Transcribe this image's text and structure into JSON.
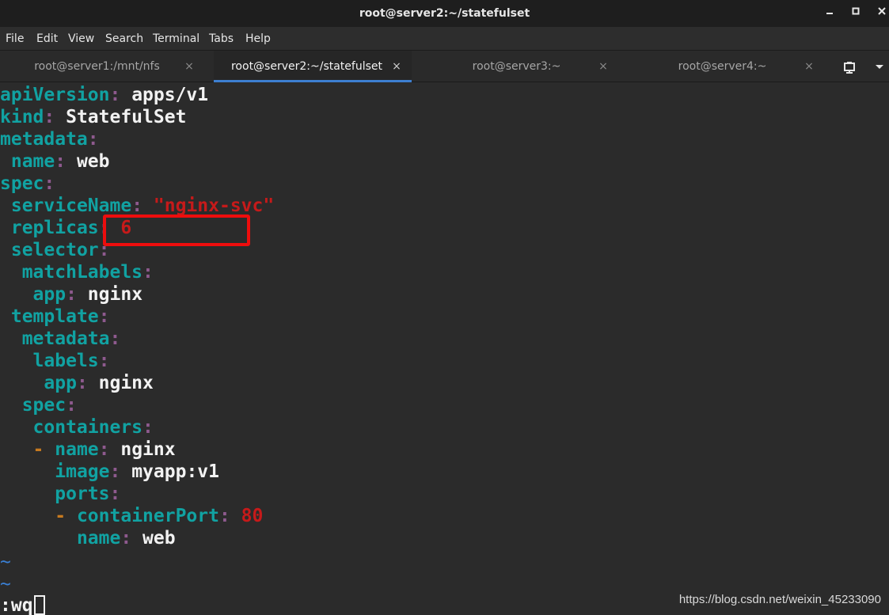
{
  "window": {
    "title": "root@server2:~/statefulset",
    "controls": {
      "minimize": "‒",
      "maximize": "▫",
      "close": "✕"
    }
  },
  "menu": [
    "File",
    "Edit",
    "View",
    "Search",
    "Terminal",
    "Tabs",
    "Help"
  ],
  "tabs": [
    {
      "label": "root@server1:/mnt/nfs",
      "close": "×",
      "active": false
    },
    {
      "label": "root@server2:~/statefulset",
      "close": "×",
      "active": true
    },
    {
      "label": "root@server3:~",
      "close": "×",
      "active": false
    },
    {
      "label": "root@server4:~",
      "close": "×",
      "active": false
    }
  ],
  "tabbar_buttons": {
    "new_tab_icon": "new-tab-icon",
    "menu_icon": "chevron-down-icon"
  },
  "editor": {
    "lines": [
      {
        "key": "apiVersion",
        "colon": ":",
        "value": " apps/v1"
      },
      {
        "key": "kind",
        "colon": ":",
        "value": " StatefulSet"
      },
      {
        "key": "metadata",
        "colon": ":",
        "value": ""
      },
      {
        "indent": " ",
        "key": "name",
        "colon": ":",
        "value": " web"
      },
      {
        "key": "spec",
        "colon": ":",
        "value": ""
      },
      {
        "indent": " ",
        "key": "serviceName",
        "colon": ":",
        "string": " \"nginx-svc\""
      },
      {
        "indent": " ",
        "key": "replicas",
        "colon": ":",
        "number": " 6"
      },
      {
        "indent": " ",
        "key": "selector",
        "colon": ":",
        "value": ""
      },
      {
        "indent": "  ",
        "key": "matchLabels",
        "colon": ":",
        "value": ""
      },
      {
        "indent": "   ",
        "key": "app",
        "colon": ":",
        "value": " nginx"
      },
      {
        "indent": " ",
        "key": "template",
        "colon": ":",
        "value": ""
      },
      {
        "indent": "  ",
        "key": "metadata",
        "colon": ":",
        "value": ""
      },
      {
        "indent": "   ",
        "key": "labels",
        "colon": ":",
        "value": ""
      },
      {
        "indent": "    ",
        "key": "app",
        "colon": ":",
        "value": " nginx"
      },
      {
        "indent": "  ",
        "key": "spec",
        "colon": ":",
        "value": ""
      },
      {
        "indent": "   ",
        "key": "containers",
        "colon": ":",
        "value": ""
      },
      {
        "indent": "   ",
        "dash": "- ",
        "key": "name",
        "colon": ":",
        "value": " nginx"
      },
      {
        "indent": "     ",
        "key": "image",
        "colon": ":",
        "value": " myapp:v1"
      },
      {
        "indent": "     ",
        "key": "ports",
        "colon": ":",
        "value": ""
      },
      {
        "indent": "     ",
        "dash": "- ",
        "key": "containerPort",
        "colon": ":",
        "number": " 80"
      },
      {
        "indent": "       ",
        "key": "name",
        "colon": ":",
        "value": " web"
      },
      {
        "tilde": "~"
      },
      {
        "tilde": "~"
      }
    ],
    "command": ":wq"
  },
  "watermark": "https://blog.csdn.net/weixin_45233090",
  "colors": {
    "key": "#11a2a2",
    "colon": "#8e5a8e",
    "value": "#f2f2f2",
    "string": "#c61a1a",
    "dash": "#c77a1f",
    "tilde": "#3a7fd3",
    "highlight": "#ee0d0d",
    "active_tab_underline": "#3d7fd0"
  }
}
